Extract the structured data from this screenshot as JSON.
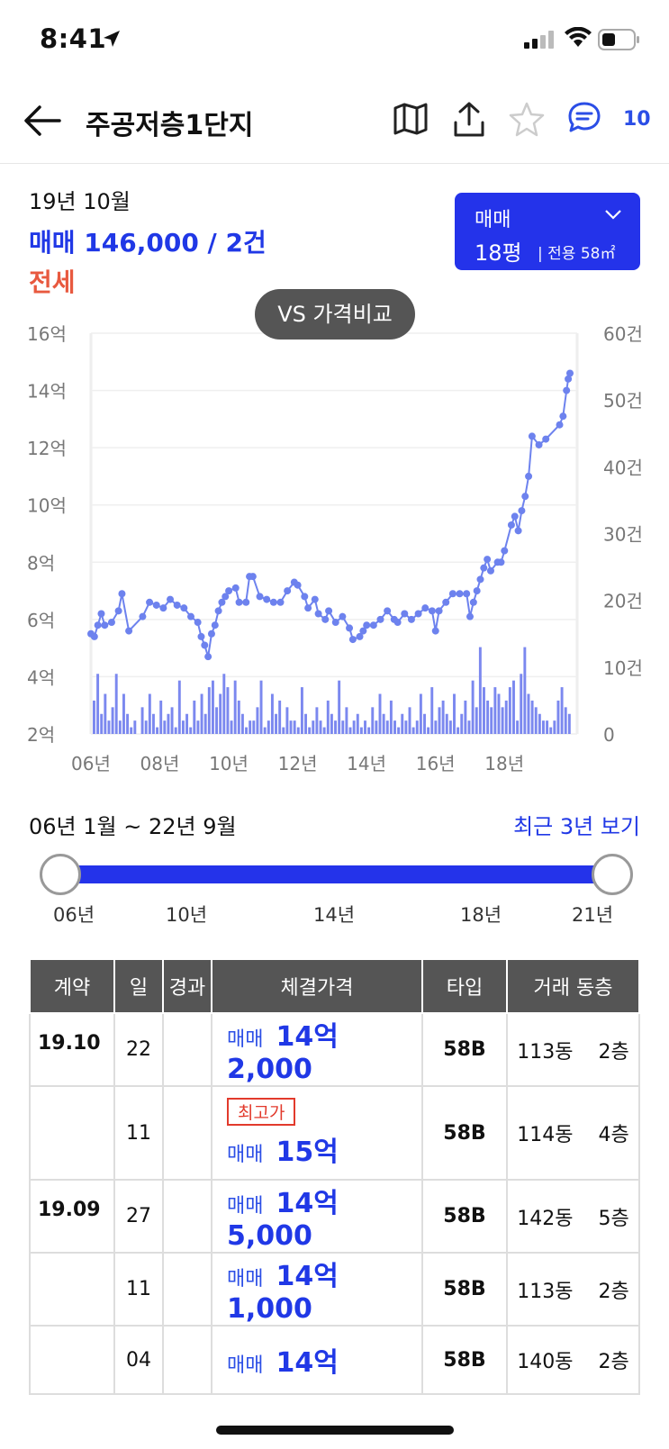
{
  "status": {
    "time": "8:41"
  },
  "header": {
    "title": "주공저층1단지",
    "comment_count": "10"
  },
  "summary": {
    "year_month": "19년 10월",
    "deal_line": "매매 146,000 / 2건",
    "jeonse": "전세"
  },
  "selector": {
    "type": "매매",
    "size": "18평",
    "area": "전용 58㎡"
  },
  "vs_button": "VS 가격비교",
  "colors": {
    "accent": "#2433ea",
    "price": "#2038e6",
    "jeonse": "#e8593f",
    "line": "#6d82ee",
    "bar": "#7b88ef"
  },
  "chart_data": {
    "type": "line",
    "ylabel_left_ticks": [
      "16억",
      "14억",
      "12억",
      "10억",
      "8억",
      "6억",
      "4억",
      "2억"
    ],
    "ylabel_right_ticks": [
      "60건",
      "50건",
      "40건",
      "30건",
      "20건",
      "10건",
      "0"
    ],
    "x_ticks": [
      "06년",
      "08년",
      "10년",
      "12년",
      "14년",
      "16년",
      "18년"
    ],
    "ylim": [
      2,
      16
    ],
    "y2lim": [
      0,
      60
    ],
    "xlim": [
      2006.0,
      2019.9
    ],
    "series": [
      {
        "values": [
          [
            2006.0,
            5.5
          ],
          [
            2006.1,
            5.4
          ],
          [
            2006.2,
            5.8
          ],
          [
            2006.3,
            6.2
          ],
          [
            2006.4,
            5.8
          ],
          [
            2006.6,
            5.9
          ],
          [
            2006.8,
            6.3
          ],
          [
            2006.9,
            6.9
          ],
          [
            2007.1,
            5.6
          ],
          [
            2007.5,
            6.1
          ],
          [
            2007.7,
            6.6
          ],
          [
            2007.9,
            6.5
          ],
          [
            2008.1,
            6.4
          ],
          [
            2008.3,
            6.7
          ],
          [
            2008.5,
            6.5
          ],
          [
            2008.7,
            6.4
          ],
          [
            2008.9,
            6.1
          ],
          [
            2009.1,
            5.9
          ],
          [
            2009.2,
            5.4
          ],
          [
            2009.3,
            5.1
          ],
          [
            2009.4,
            4.7
          ],
          [
            2009.5,
            5.5
          ],
          [
            2009.6,
            5.8
          ],
          [
            2009.7,
            6.3
          ],
          [
            2009.8,
            6.6
          ],
          [
            2009.9,
            6.8
          ],
          [
            2010.0,
            7.0
          ],
          [
            2010.2,
            7.1
          ],
          [
            2010.3,
            6.6
          ],
          [
            2010.5,
            6.6
          ],
          [
            2010.6,
            7.5
          ],
          [
            2010.7,
            7.5
          ],
          [
            2010.9,
            6.8
          ],
          [
            2011.1,
            6.7
          ],
          [
            2011.3,
            6.6
          ],
          [
            2011.5,
            6.6
          ],
          [
            2011.7,
            7.0
          ],
          [
            2011.9,
            7.3
          ],
          [
            2012.0,
            7.2
          ],
          [
            2012.2,
            6.8
          ],
          [
            2012.3,
            6.4
          ],
          [
            2012.5,
            6.7
          ],
          [
            2012.6,
            6.2
          ],
          [
            2012.8,
            6.0
          ],
          [
            2012.9,
            6.3
          ],
          [
            2013.1,
            5.9
          ],
          [
            2013.3,
            6.1
          ],
          [
            2013.5,
            5.7
          ],
          [
            2013.6,
            5.3
          ],
          [
            2013.8,
            5.4
          ],
          [
            2013.9,
            5.6
          ],
          [
            2014.0,
            5.8
          ],
          [
            2014.2,
            5.8
          ],
          [
            2014.4,
            6.0
          ],
          [
            2014.6,
            6.3
          ],
          [
            2014.8,
            6.0
          ],
          [
            2014.9,
            5.9
          ],
          [
            2015.1,
            6.2
          ],
          [
            2015.3,
            6.0
          ],
          [
            2015.5,
            6.2
          ],
          [
            2015.7,
            6.4
          ],
          [
            2015.9,
            6.3
          ],
          [
            2016.0,
            5.6
          ],
          [
            2016.1,
            6.3
          ],
          [
            2016.3,
            6.6
          ],
          [
            2016.5,
            6.9
          ],
          [
            2016.7,
            6.9
          ],
          [
            2016.9,
            6.9
          ],
          [
            2017.0,
            6.1
          ],
          [
            2017.1,
            6.6
          ],
          [
            2017.2,
            7.0
          ],
          [
            2017.3,
            7.4
          ],
          [
            2017.4,
            7.8
          ],
          [
            2017.5,
            8.1
          ],
          [
            2017.6,
            7.7
          ],
          [
            2017.8,
            8.0
          ],
          [
            2017.9,
            8.0
          ],
          [
            2018.0,
            8.4
          ],
          [
            2018.2,
            9.3
          ],
          [
            2018.3,
            9.6
          ],
          [
            2018.4,
            9.1
          ],
          [
            2018.5,
            9.8
          ],
          [
            2018.6,
            10.3
          ],
          [
            2018.7,
            11.0
          ],
          [
            2018.8,
            12.4
          ],
          [
            2019.0,
            12.1
          ],
          [
            2019.2,
            12.3
          ],
          [
            2019.6,
            12.8
          ],
          [
            2019.7,
            13.1
          ],
          [
            2019.8,
            14.0
          ],
          [
            2019.85,
            14.4
          ],
          [
            2019.9,
            14.6
          ]
        ]
      }
    ],
    "volume_bars": [
      5,
      9,
      3,
      6,
      2,
      4,
      9,
      2,
      6,
      3,
      1,
      2,
      0,
      4,
      2,
      6,
      3,
      1,
      5,
      2,
      3,
      4,
      1,
      8,
      2,
      3,
      1,
      5,
      2,
      6,
      3,
      7,
      8,
      4,
      6,
      9,
      7,
      2,
      8,
      5,
      3,
      1,
      2,
      2,
      4,
      8,
      1,
      2,
      6,
      3,
      5,
      1,
      4,
      2,
      2,
      1,
      7,
      3,
      1,
      2,
      4,
      2,
      1,
      5,
      3,
      2,
      8,
      2,
      4,
      1,
      2,
      3,
      1,
      2,
      1,
      4,
      2,
      6,
      3,
      2,
      5,
      2,
      1,
      3,
      2,
      4,
      1,
      2,
      6,
      3,
      1,
      7,
      2,
      4,
      5,
      3,
      2,
      6,
      1,
      3,
      5,
      2,
      8,
      4,
      13,
      7,
      5,
      4,
      7,
      6,
      4,
      5,
      7,
      8,
      2,
      9,
      13,
      6,
      5,
      4,
      3,
      2,
      2,
      1,
      2,
      5,
      7,
      4,
      3
    ]
  },
  "range": {
    "label": "06년 1월 ~ 22년 9월",
    "recent_link": "최근 3년 보기",
    "ticks": [
      "06년",
      "10년",
      "14년",
      "18년",
      "21년"
    ]
  },
  "table": {
    "headers": [
      "계약",
      "일",
      "경과",
      "체결가격",
      "타입",
      "거래 동층"
    ],
    "rows": [
      {
        "month": "19.10",
        "day": "22",
        "kind": "매매",
        "price": "14억 2,000",
        "type": "58B",
        "dong": "113동",
        "floor": "2층"
      },
      {
        "month": "",
        "day": "11",
        "badge": "최고가",
        "kind": "매매",
        "price": "15억",
        "type": "58B",
        "dong": "114동",
        "floor": "4층"
      },
      {
        "month": "19.09",
        "day": "27",
        "kind": "매매",
        "price": "14억 5,000",
        "type": "58B",
        "dong": "142동",
        "floor": "5층"
      },
      {
        "month": "",
        "day": "11",
        "kind": "매매",
        "price": "14억 1,000",
        "type": "58B",
        "dong": "113동",
        "floor": "2층"
      },
      {
        "month": "",
        "day": "04",
        "kind": "매매",
        "price": "14억",
        "type": "58B",
        "dong": "140동",
        "floor": "2층"
      }
    ]
  }
}
